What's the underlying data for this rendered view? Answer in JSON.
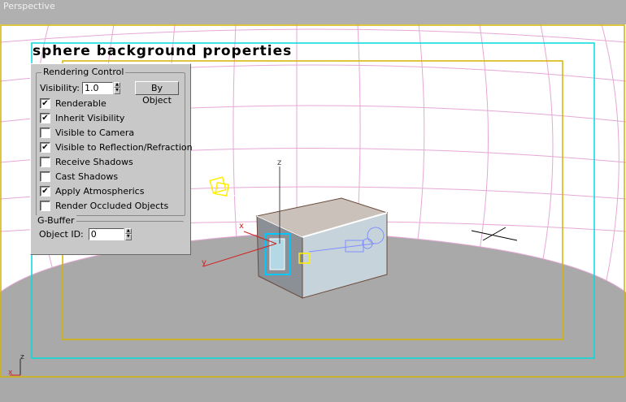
{
  "viewport": {
    "label": "Perspective"
  },
  "overlay": {
    "title": "sphere background properties"
  },
  "rendering_control": {
    "legend": "Rendering Control",
    "visibility_label": "Visibility:",
    "visibility_value": "1.0",
    "by_object_label": "By Object",
    "options": [
      {
        "label": "Renderable",
        "checked": true
      },
      {
        "label": "Inherit Visibility",
        "checked": true
      },
      {
        "label": "Visible to Camera",
        "checked": false
      },
      {
        "label": "Visible to Reflection/Refraction",
        "checked": true
      },
      {
        "label": "Receive Shadows",
        "checked": false
      },
      {
        "label": "Cast Shadows",
        "checked": false
      },
      {
        "label": "Apply Atmospherics",
        "checked": true
      },
      {
        "label": "Render Occluded Objects",
        "checked": false
      }
    ]
  },
  "g_buffer": {
    "legend": "G-Buffer",
    "object_id_label": "Object ID:",
    "object_id_value": "0"
  },
  "axes": {
    "z": "z",
    "x": "x",
    "y": "y",
    "world_z": "z",
    "world_x": "x"
  },
  "colors": {
    "grid": "#e6a8d6",
    "safe_frame": "#00dcdc",
    "action_frame": "#d4b400",
    "ground": "#a9a9a9",
    "sky": "#ffffff"
  }
}
